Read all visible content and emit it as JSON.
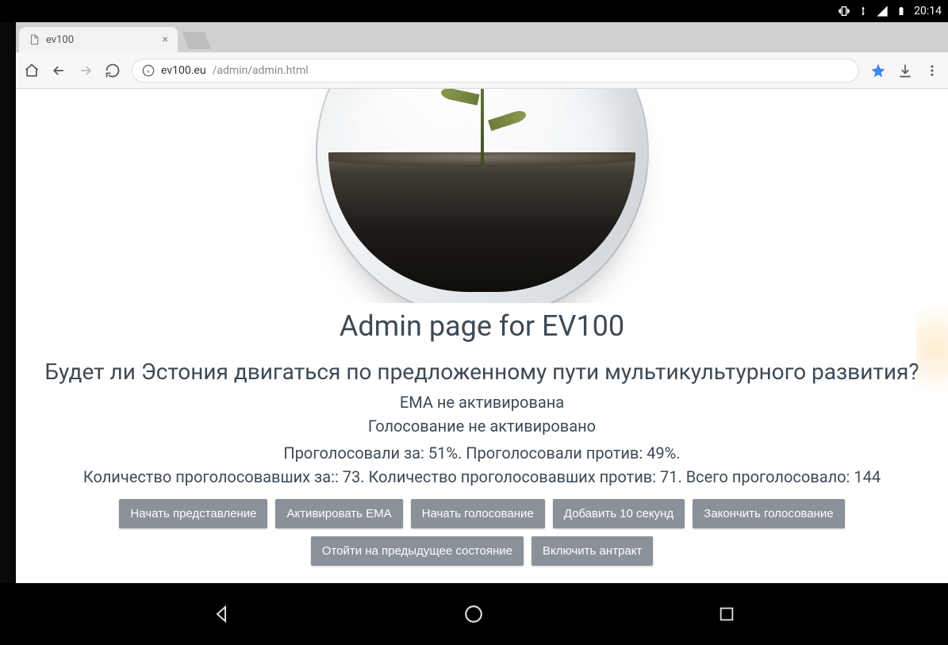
{
  "android_status": {
    "time": "20:14"
  },
  "tab": {
    "title": "ev100"
  },
  "omnibox": {
    "host": "ev100.eu",
    "path": "/admin/admin.html"
  },
  "page": {
    "title": "Admin page for EV100",
    "question": "Будет ли Эстония двигаться по предложенному пути мультикультурного развития?",
    "ema_status": "ЕМА не активирована",
    "vote_status": "Голосование не активировано",
    "percent_line": "Проголосовали за: 51%. Проголосовали против: 49%.",
    "count_line": "Количество проголосовавших за:: 73. Количество проголосовавших против: 71. Всего проголосовало: 144",
    "vote_for_percent": 51,
    "vote_against_percent": 49,
    "vote_for_count": 73,
    "vote_against_count": 71,
    "vote_total": 144
  },
  "buttons": {
    "start_show": "Начать представление",
    "activate_ema": "Активировать ЕМА",
    "start_vote": "Начать голосование",
    "add_10s": "Добавить 10 секунд",
    "end_vote": "Закончить голосование",
    "rollback": "Отойти на предыдущее состояние",
    "intermission": "Включить антракт"
  }
}
